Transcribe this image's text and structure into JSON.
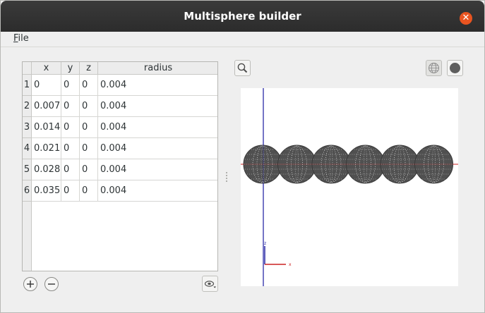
{
  "window": {
    "title": "Multisphere builder",
    "close_icon": "close-icon"
  },
  "menu": {
    "file_mnemonic": "F",
    "file_rest": "ile"
  },
  "table": {
    "headers": [
      "x",
      "y",
      "z",
      "radius"
    ],
    "rows": [
      {
        "num": "1",
        "x": "0",
        "y": "0",
        "z": "0",
        "radius": "0.004"
      },
      {
        "num": "2",
        "x": "0.007",
        "y": "0",
        "z": "0",
        "radius": "0.004"
      },
      {
        "num": "3",
        "x": "0.014",
        "y": "0",
        "z": "0",
        "radius": "0.004"
      },
      {
        "num": "4",
        "x": "0.021",
        "y": "0",
        "z": "0",
        "radius": "0.004"
      },
      {
        "num": "5",
        "x": "0.028",
        "y": "0",
        "z": "0",
        "radius": "0.004"
      },
      {
        "num": "6",
        "x": "0.035",
        "y": "0",
        "z": "0",
        "radius": "0.004"
      }
    ]
  },
  "buttons": {
    "add_icon": "plus-icon",
    "remove_icon": "minus-icon",
    "options_icon": "settings-dropdown-icon"
  },
  "viewer": {
    "zoom_icon": "magnifier-icon",
    "wireframe_icon": "wireframe-sphere-icon",
    "solid_icon": "solid-sphere-icon",
    "axis_labels": {
      "z": "z",
      "x": "x"
    },
    "sphere_count": 6,
    "colors": {
      "x_axis": "#cc2222",
      "y_axis": "#22aa22",
      "z_axis": "#1a1aa0",
      "sphere": "#505050"
    }
  }
}
